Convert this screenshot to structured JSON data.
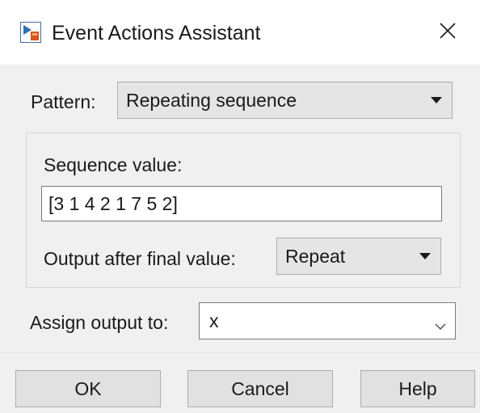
{
  "window": {
    "title": "Event Actions Assistant"
  },
  "icons": {
    "app": "simulink-event-icon",
    "close": "close-icon",
    "dropdown": "caret-down-icon",
    "chevron": "chevron-down-icon"
  },
  "pattern": {
    "label": "Pattern:",
    "selected": "Repeating sequence"
  },
  "sequence": {
    "label": "Sequence value:",
    "value": "[3 1 4 2 1 7 5 2]"
  },
  "output_after": {
    "label": "Output after final value:",
    "selected": "Repeat"
  },
  "assign": {
    "label": "Assign output to:",
    "value": "x"
  },
  "buttons": {
    "ok": "OK",
    "cancel": "Cancel",
    "help": "Help"
  },
  "colors": {
    "background": "#f0f0f0",
    "titlebar": "#ffffff",
    "button": "#e1e1e1"
  }
}
